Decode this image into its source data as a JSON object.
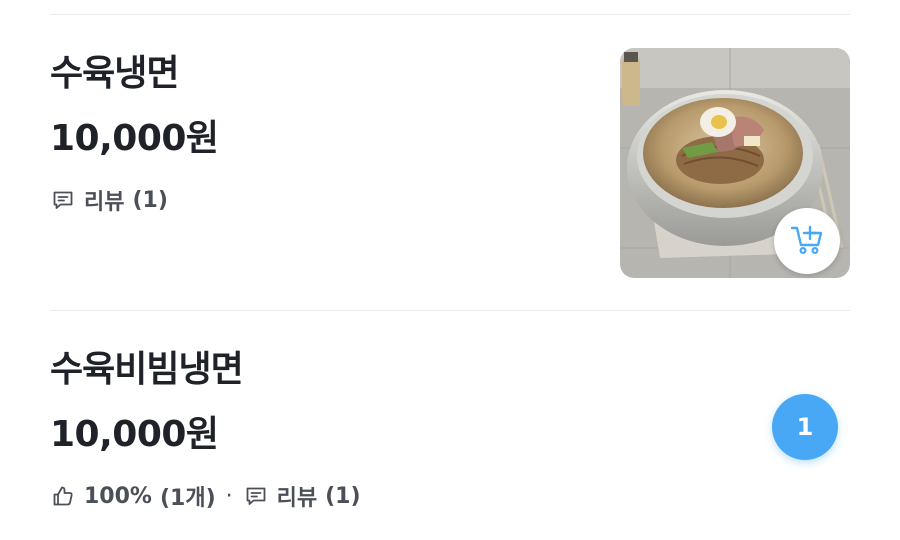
{
  "menu_items": [
    {
      "name": "수육냉면",
      "price": "10,000원",
      "review_label": "리뷰",
      "review_count": "(1)",
      "image_icon": "naengmyeon-photo",
      "cart_icon": "add-to-cart-icon"
    },
    {
      "name": "수육비빔냉면",
      "price": "10,000원",
      "like_percent": "100%",
      "like_count": "(1개)",
      "separator": "·",
      "review_label": "리뷰",
      "review_count": "(1)",
      "quantity_badge": "1"
    }
  ],
  "colors": {
    "accent": "#49a8f5",
    "text_primary": "#1f2329",
    "text_secondary": "#4b5058",
    "divider": "#ececef"
  }
}
